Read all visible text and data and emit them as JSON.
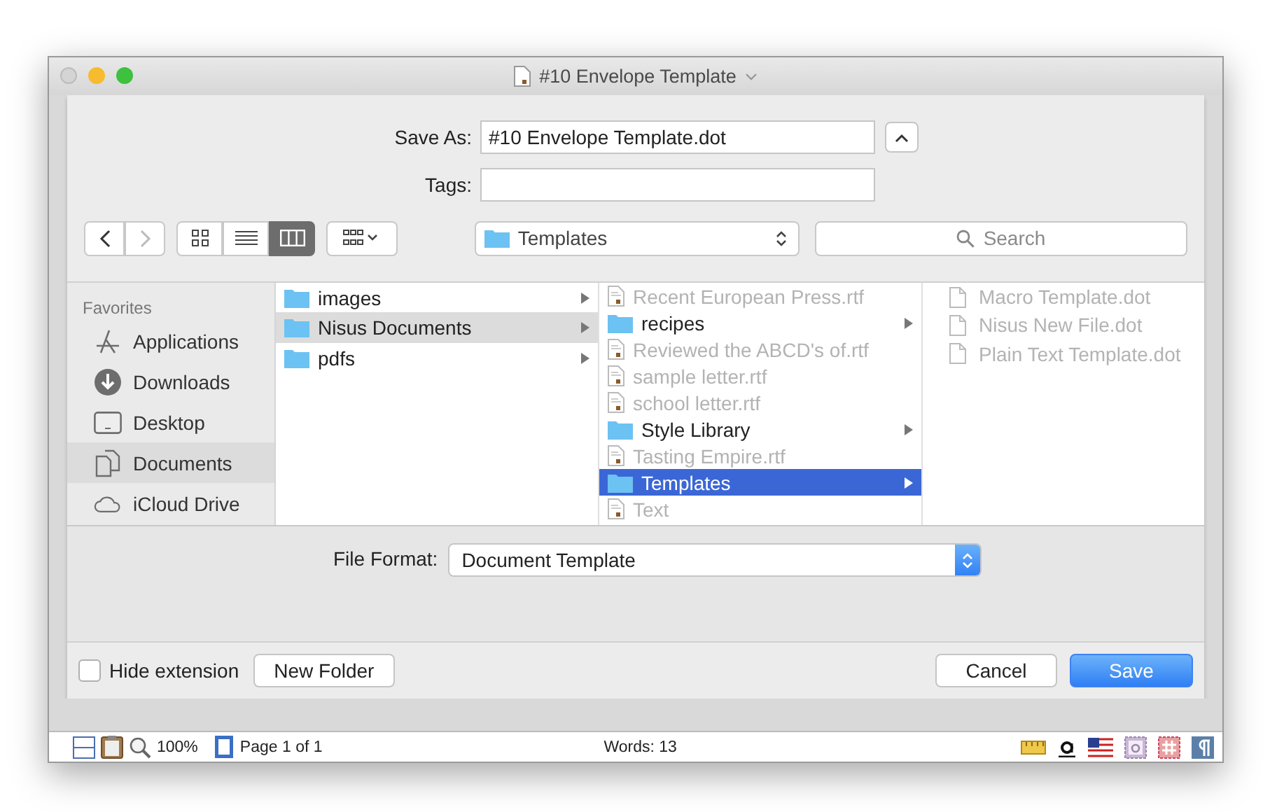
{
  "window": {
    "title": "#10 Envelope Template"
  },
  "save_as": {
    "label": "Save As:",
    "value": "#10 Envelope Template.dot",
    "expanded": true
  },
  "tags": {
    "label": "Tags:"
  },
  "toolbar": {
    "view_modes": [
      {
        "kind": "icons",
        "selected": false
      },
      {
        "kind": "list",
        "selected": false
      },
      {
        "kind": "columns",
        "selected": true
      }
    ],
    "location": "Templates",
    "search": {
      "placeholder": "Search"
    }
  },
  "sidebar": {
    "heading": "Favorites",
    "items": [
      {
        "kind": "applications",
        "label": "Applications",
        "selected": false
      },
      {
        "kind": "downloads",
        "label": "Downloads",
        "selected": false
      },
      {
        "kind": "desktop",
        "label": "Desktop",
        "selected": false
      },
      {
        "kind": "documents",
        "label": "Documents",
        "selected": true
      },
      {
        "kind": "cloud",
        "label": "iCloud Drive",
        "selected": false
      }
    ]
  },
  "columns": [
    {
      "focused": false,
      "items": [
        {
          "kind": "folder",
          "name": "images",
          "disabled": false,
          "selected": false
        },
        {
          "kind": "folder",
          "name": "Nisus Documents",
          "disabled": false,
          "selected": true
        },
        {
          "kind": "folder",
          "name": "pdfs",
          "disabled": false,
          "selected": false
        }
      ]
    },
    {
      "focused": true,
      "items": [
        {
          "kind": "rich_text",
          "name": "Recent European Press.rtf",
          "disabled": true,
          "selected": false
        },
        {
          "kind": "folder",
          "name": "recipes",
          "disabled": false,
          "selected": false
        },
        {
          "kind": "rich_text",
          "name": "Reviewed the ABCD's of.rtf",
          "disabled": true,
          "selected": false
        },
        {
          "kind": "rich_text",
          "name": "sample letter.rtf",
          "disabled": true,
          "selected": false
        },
        {
          "kind": "rich_text",
          "name": "school letter.rtf",
          "disabled": true,
          "selected": false
        },
        {
          "kind": "folder",
          "name": "Style Library",
          "disabled": false,
          "selected": false
        },
        {
          "kind": "rich_text",
          "name": "Tasting Empire.rtf",
          "disabled": true,
          "selected": false
        },
        {
          "kind": "folder",
          "name": "Templates",
          "disabled": false,
          "selected": true
        },
        {
          "kind": "rich_text",
          "name": "Text",
          "disabled": true,
          "selected": false
        }
      ]
    },
    {
      "focused": false,
      "items": [
        {
          "kind": "template",
          "name": "Macro Template.dot",
          "disabled": true,
          "selected": false
        },
        {
          "kind": "template",
          "name": "Nisus New File.dot",
          "disabled": true,
          "selected": false
        },
        {
          "kind": "template",
          "name": "Plain Text Template.dot",
          "disabled": true,
          "selected": false
        }
      ]
    }
  ],
  "file_format": {
    "label": "File Format:",
    "value": "Document Template"
  },
  "hide_extension": {
    "label": "Hide extension",
    "checked": false
  },
  "buttons": [
    {
      "kind": "new_folder",
      "label": "New Folder"
    },
    {
      "kind": "cancel",
      "label": "Cancel"
    },
    {
      "kind": "save",
      "label": "Save"
    }
  ],
  "status_bar": {
    "zoom": "100%",
    "page": "Page 1 of 1",
    "words": "Words: 13"
  }
}
